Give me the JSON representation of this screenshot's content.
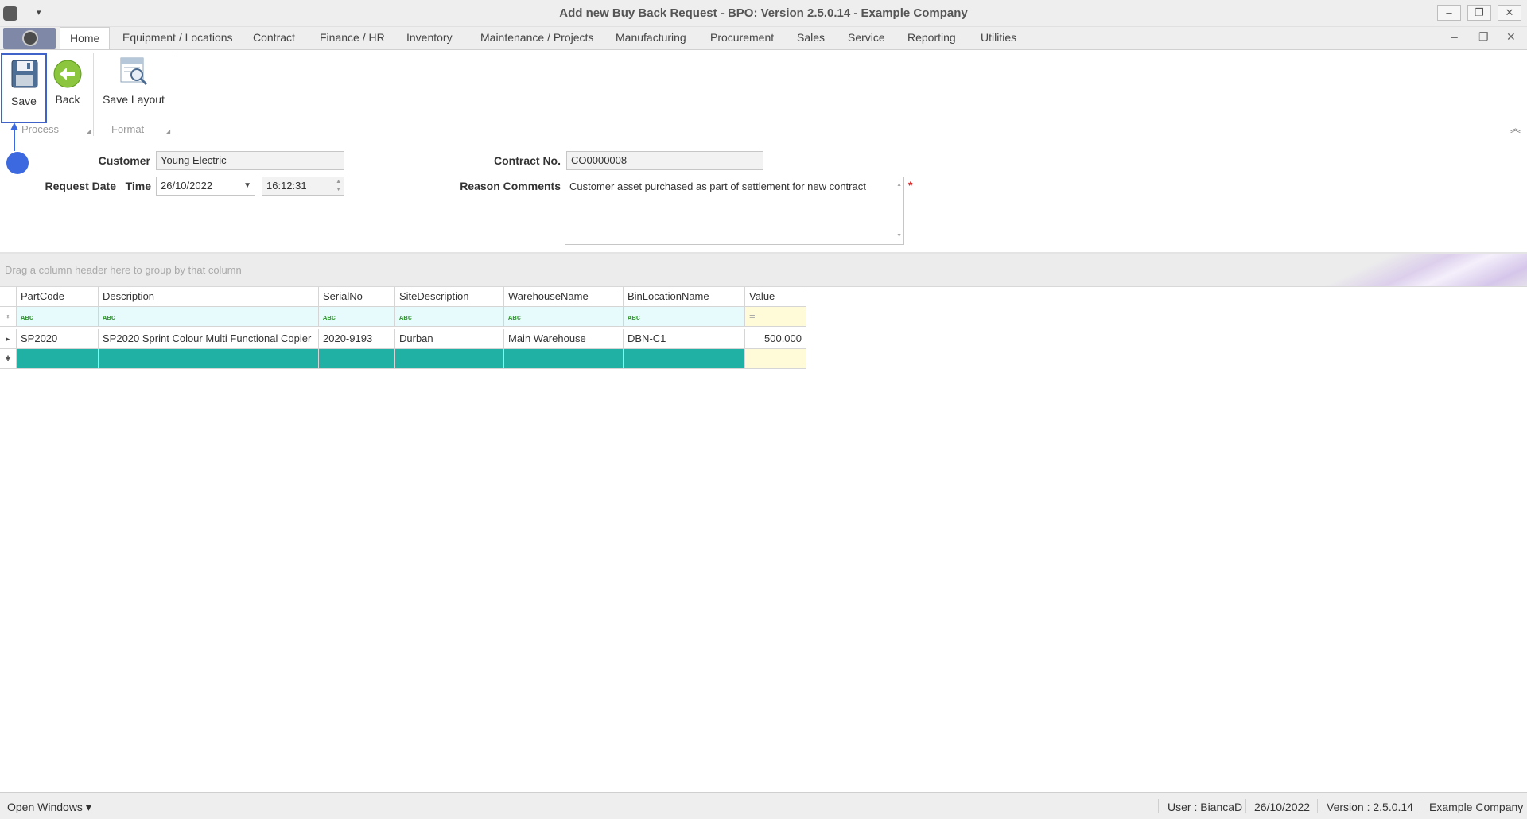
{
  "window": {
    "title": "Add new Buy Back Request - BPO: Version 2.5.0.14 - Example Company",
    "qat_dropdown": "▾",
    "controls": {
      "minimize": "–",
      "restore": "❐",
      "close": "✕"
    }
  },
  "ribbon_tabs": [
    "Home",
    "Equipment / Locations",
    "Contract",
    "Finance / HR",
    "Inventory",
    "Maintenance / Projects",
    "Manufacturing",
    "Procurement",
    "Sales",
    "Service",
    "Reporting",
    "Utilities"
  ],
  "mdi_controls": {
    "minimize": "–",
    "restore": "❐",
    "close": "✕"
  },
  "ribbon": {
    "groups": {
      "process": "Process",
      "format": "Format"
    },
    "buttons": {
      "save": "Save",
      "back": "Back",
      "save_layout": "Save Layout"
    },
    "launcher_glyph": "◢",
    "collapse_glyph": "︽"
  },
  "form": {
    "customer_label": "Customer",
    "customer_value": "Young Electric",
    "request_date_label": "Request Date",
    "time_label": "Time",
    "date_value": "26/10/2022",
    "time_value": "16:12:31",
    "contract_no_label": "Contract No.",
    "contract_no_value": "CO0000008",
    "reason_label": "Reason Comments",
    "reason_value": "Customer asset purchased as part of settlement for new contract",
    "required_marker": "*"
  },
  "grid": {
    "group_hint": "Drag a column header here to group by that column",
    "columns": [
      "PartCode",
      "Description",
      "SerialNo",
      "SiteDescription",
      "WarehouseName",
      "BinLocationName",
      "Value"
    ],
    "filter_text_glyph": "ᴀʙc",
    "filter_num_glyph": "=",
    "filter_row_icon": "♀",
    "row_indicator": "▸",
    "new_row_indicator": "✱",
    "rows": [
      {
        "cells": [
          "SP2020",
          "SP2020 Sprint Colour Multi Functional Copier",
          "2020-9193",
          "Durban",
          "Main Warehouse",
          "DBN-C1",
          "500.000"
        ]
      }
    ]
  },
  "status_bar": {
    "open_windows": "Open Windows ▾",
    "user": "User : BiancaD",
    "date": "26/10/2022",
    "version": "Version : 2.5.0.14",
    "company": "Example Company"
  },
  "colors": {
    "accent": "#3c69e0",
    "new_row": "#21b0a4",
    "filter_text_bg": "#e7fbfd",
    "filter_num_bg": "#fffbd9",
    "required": "#d92b2b"
  }
}
